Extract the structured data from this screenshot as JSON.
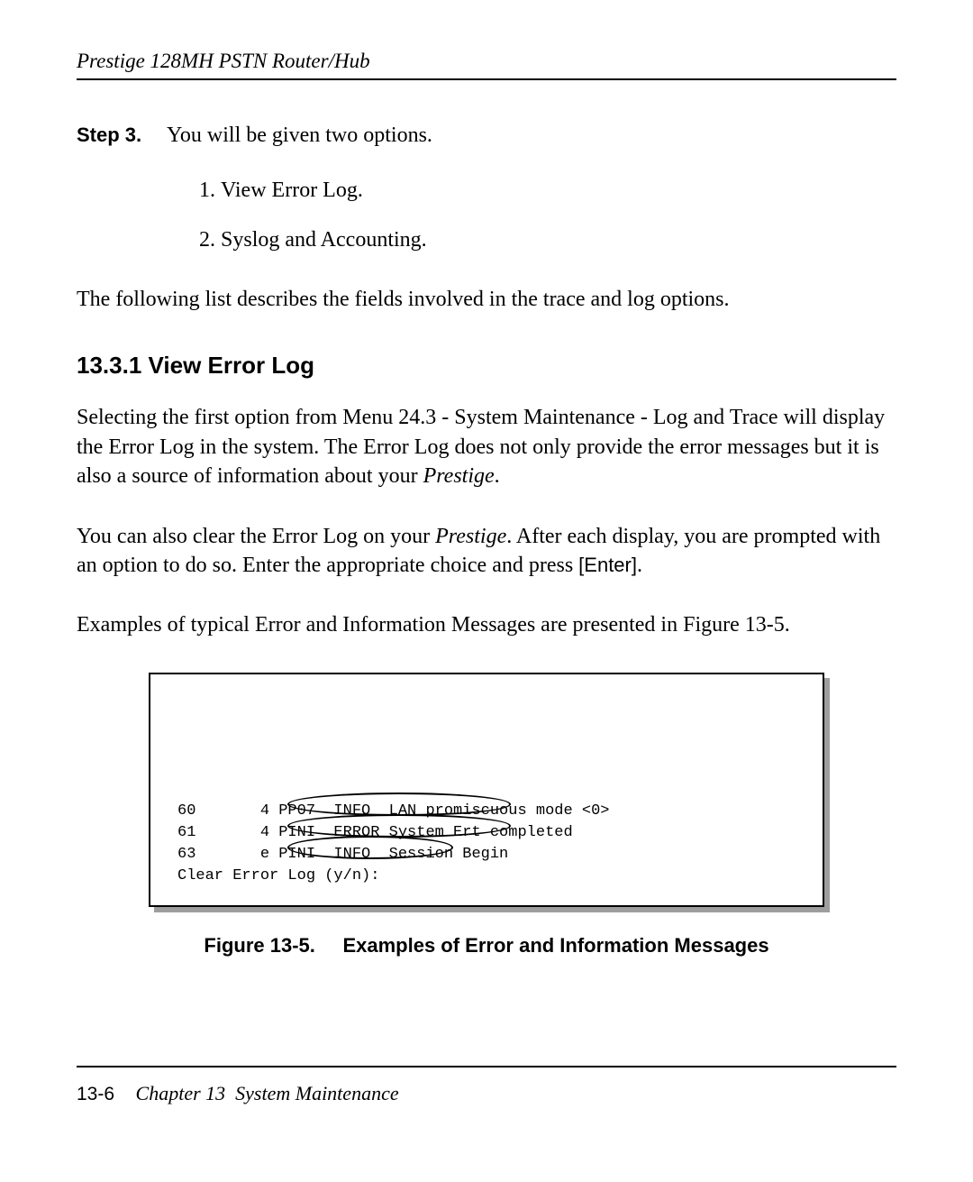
{
  "header": {
    "product": "Prestige 128MH   PSTN Router/Hub"
  },
  "step": {
    "label": "Step 3.",
    "text": "You will be given two options."
  },
  "options": {
    "item1": "View Error Log.",
    "item2": "Syslog and Accounting."
  },
  "intro_after_options": "The following list describes the fields involved in the trace and log options.",
  "section_heading": "13.3.1 View Error Log",
  "para1_a": "Selecting the first option from Menu 24.3 - System Maintenance - Log and Trace will display the Error Log in the system. The Error Log does not only provide the error messages but it is also a source of information about your ",
  "para1_italic": "Prestige",
  "para1_b": ".",
  "para2_a": "You can also clear the Error Log on your ",
  "para2_italic": "Prestige",
  "para2_b": ". After each display, you are prompted with an option to do so. Enter the appropriate choice and press ",
  "para2_enter": "[Enter]",
  "para2_c": ".",
  "para3": "Examples of typical Error and Information Messages are presented in Figure 13-5.",
  "figure": {
    "lines": "60       4 PP07  INFO  LAN promiscuous mode <0>\n61       4 PINI  ERROR System Ert completed\n63       e PINI  INFO  Session Begin\nClear Error Log (y/n):",
    "caption_label": "Figure 13-5.",
    "caption_text": "Examples of Error and Information Messages"
  },
  "footer": {
    "page_number": "13-6",
    "chapter_prefix": "Chapter 13",
    "chapter_title": "System Maintenance"
  }
}
